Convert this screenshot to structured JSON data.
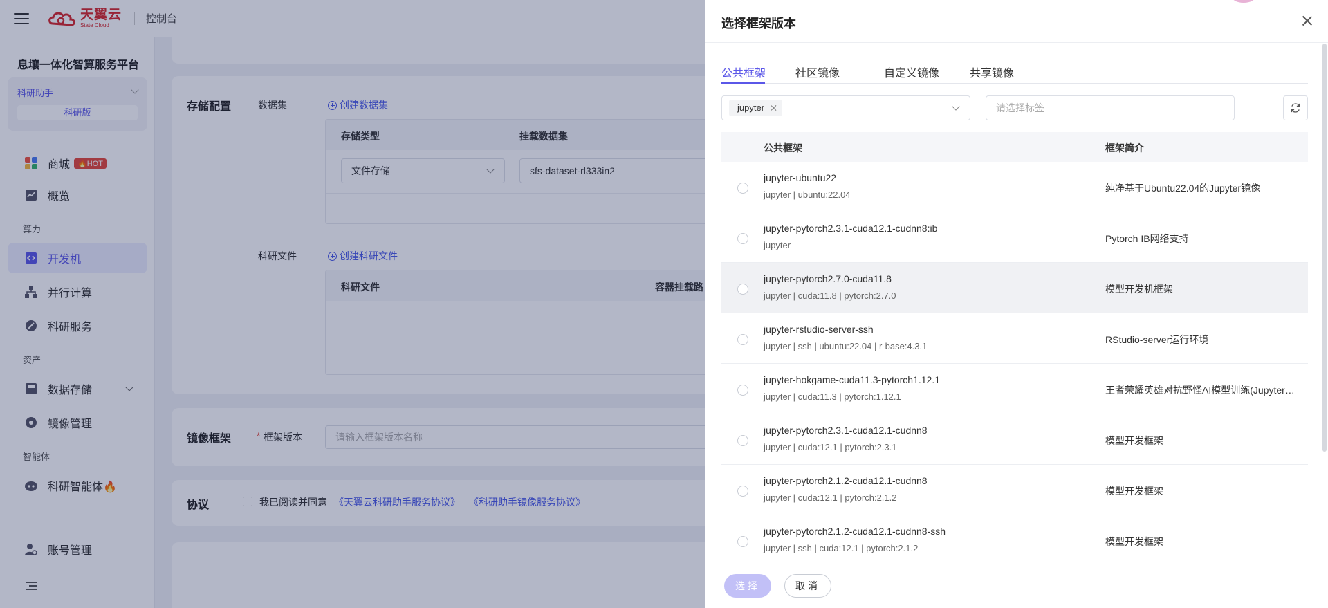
{
  "topbar": {
    "logo_cn": "天翼云",
    "logo_en": "State Cloud",
    "console": "控制台"
  },
  "sidebar": {
    "platform_title": "息壤一体化智算服务平台",
    "workspace_name": "科研助手",
    "workspace_tag": "科研版",
    "items": [
      {
        "label": "商城",
        "badge": "🔥HOT"
      },
      {
        "label": "概览"
      },
      {
        "label": "开发机"
      },
      {
        "label": "并行计算"
      },
      {
        "label": "科研服务"
      },
      {
        "label": "数据存储"
      },
      {
        "label": "镜像管理"
      },
      {
        "label": "科研智能体🔥"
      },
      {
        "label": "账号管理"
      }
    ],
    "sections": [
      "算力",
      "资产",
      "智能体"
    ]
  },
  "main": {
    "storage": {
      "title": "存储配置",
      "dataset_label": "数据集",
      "create_dataset": "创建数据集",
      "col_storage_type": "存储类型",
      "col_mount_dataset": "挂载数据集",
      "storage_type_value": "文件存储",
      "dataset_value": "sfs-dataset-rl333in2",
      "research_file_label": "科研文件",
      "create_research_file": "创建科研文件",
      "col_research_file": "科研文件",
      "col_container_path": "容器挂载路"
    },
    "image": {
      "title": "镜像框架",
      "required_mark": "*",
      "version_label": "框架版本",
      "version_placeholder": "请输入框架版本名称"
    },
    "agreement": {
      "title": "协议",
      "text": "我已阅读并同意",
      "link1": "《天翼云科研助手服务协议》",
      "link2": "《科研助手镜像服务协议》"
    }
  },
  "drawer": {
    "title": "选择框架版本",
    "tabs": [
      "公共框架",
      "社区镜像",
      "自定义镜像",
      "共享镜像"
    ],
    "filter_chip": "jupyter",
    "tag_placeholder": "请选择标签",
    "columns": {
      "name": "公共框架",
      "desc": "框架简介"
    },
    "rows": [
      {
        "name": "jupyter-ubuntu22",
        "tags": "jupyter | ubuntu:22.04",
        "desc": "纯净基于Ubuntu22.04的Jupyter镜像"
      },
      {
        "name": "jupyter-pytorch2.3.1-cuda12.1-cudnn8:ib",
        "tags": "jupyter",
        "desc": "Pytorch IB网络支持"
      },
      {
        "name": "jupyter-pytorch2.7.0-cuda11.8",
        "tags": "jupyter | cuda:11.8 | pytorch:2.7.0",
        "desc": "模型开发机框架"
      },
      {
        "name": "jupyter-rstudio-server-ssh",
        "tags": "jupyter | ssh | ubuntu:22.04 | r-base:4.3.1",
        "desc": "RStudio-server运行环境"
      },
      {
        "name": "jupyter-hokgame-cuda11.3-pytorch1.12.1",
        "tags": "jupyter | cuda:11.3 | pytorch:1.12.1",
        "desc": "王者荣耀英雄对抗野怪AI模型训练(Jupyter镜像)"
      },
      {
        "name": "jupyter-pytorch2.3.1-cuda12.1-cudnn8",
        "tags": "jupyter | cuda:12.1 | pytorch:2.3.1",
        "desc": "模型开发框架"
      },
      {
        "name": "jupyter-pytorch2.1.2-cuda12.1-cudnn8",
        "tags": "jupyter | cuda:12.1 | pytorch:2.1.2",
        "desc": "模型开发框架"
      },
      {
        "name": "jupyter-pytorch2.1.2-cuda12.1-cudnn8-ssh",
        "tags": "jupyter | ssh | cuda:12.1 | pytorch:2.1.2",
        "desc": "模型开发框架"
      }
    ],
    "select_label": "选择",
    "cancel_label": "取消"
  },
  "colors": {
    "accent": "#5b57e8",
    "link": "#4a5ae8",
    "brand_red": "#d7272c",
    "hot": "#e5483a"
  }
}
